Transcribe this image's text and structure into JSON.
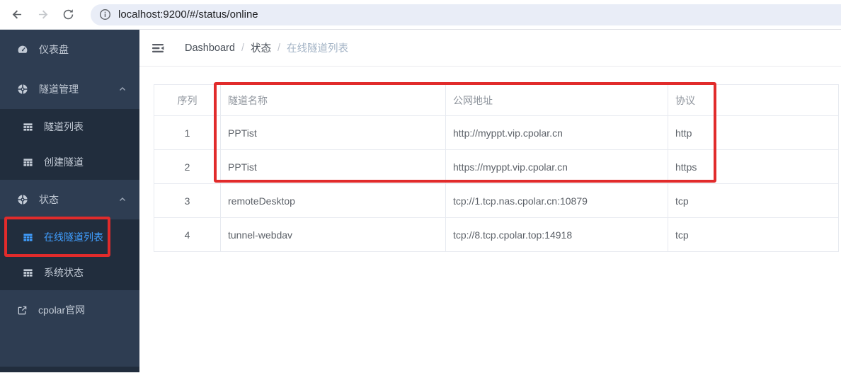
{
  "browser": {
    "url": "localhost:9200/#/status/online",
    "icons": {
      "back": "back-arrow-icon",
      "forward": "forward-arrow-icon",
      "refresh": "refresh-icon",
      "page_info": "info-icon"
    }
  },
  "sidebar": {
    "items": [
      {
        "label": "仪表盘",
        "icon": "gauge-icon",
        "level": "top"
      },
      {
        "label": "隧道管理",
        "icon": "circle-icon",
        "level": "top",
        "expanded": true
      },
      {
        "label": "隧道列表",
        "icon": "table-icon",
        "level": "sub"
      },
      {
        "label": "创建隧道",
        "icon": "table-icon",
        "level": "sub"
      },
      {
        "label": "状态",
        "icon": "circle-icon",
        "level": "top",
        "expanded": true
      },
      {
        "label": "在线隧道列表",
        "icon": "table-icon",
        "level": "sub",
        "active": true
      },
      {
        "label": "系统状态",
        "icon": "table-icon",
        "level": "sub"
      },
      {
        "label": "cpolar官网",
        "icon": "external-link-icon",
        "level": "top"
      }
    ]
  },
  "breadcrumb": {
    "separator": "/",
    "items": [
      "Dashboard",
      "状态",
      "在线隧道列表"
    ]
  },
  "table": {
    "headers": [
      "序列",
      "隧道名称",
      "公网地址",
      "协议"
    ],
    "rows": [
      [
        "1",
        "PPTist",
        "http://myppt.vip.cpolar.cn",
        "http"
      ],
      [
        "2",
        "PPTist",
        "https://myppt.vip.cpolar.cn",
        "https"
      ],
      [
        "3",
        "remoteDesktop",
        "tcp://1.tcp.nas.cpolar.cn:10879",
        "tcp"
      ],
      [
        "4",
        "tunnel-webdav",
        "tcp://8.tcp.cpolar.top:14918",
        "tcp"
      ]
    ]
  },
  "colors": {
    "accent": "#409eff",
    "annotation": "#e12b2b",
    "sidebar_bg": "#2e3d52",
    "submenu_bg": "#212d3d",
    "menu_text": "#c3cbd6"
  }
}
